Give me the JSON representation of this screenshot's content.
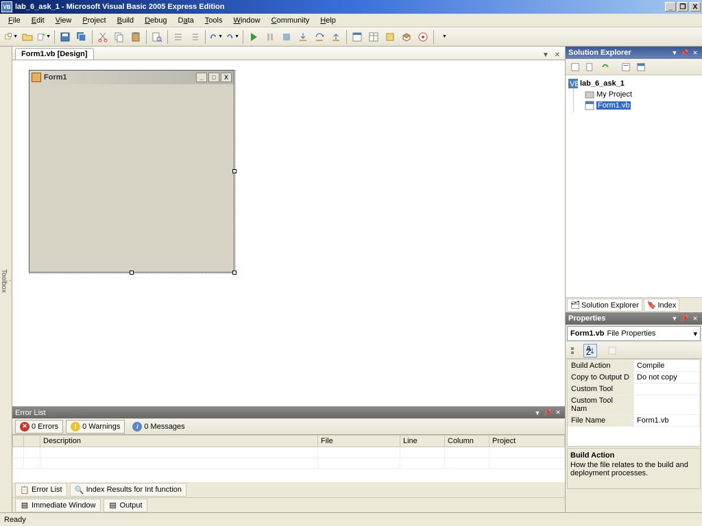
{
  "title": "lab_6_ask_1 - Microsoft Visual Basic 2005 Express Edition",
  "menu": [
    "File",
    "Edit",
    "View",
    "Project",
    "Build",
    "Debug",
    "Data",
    "Tools",
    "Window",
    "Community",
    "Help"
  ],
  "doc_tab": "Form1.vb [Design]",
  "form": {
    "title": "Form1"
  },
  "error_list": {
    "header": "Error List",
    "errors": "0 Errors",
    "warnings": "0 Warnings",
    "messages": "0 Messages",
    "cols": {
      "desc": "Description",
      "file": "File",
      "line": "Line",
      "col": "Column",
      "proj": "Project"
    }
  },
  "bottom_tabs": {
    "errlist": "Error List",
    "index": "Index Results for Int function"
  },
  "bottom_tabs2": {
    "imm": "Immediate Window",
    "out": "Output"
  },
  "solution_explorer": {
    "header": "Solution Explorer",
    "root": "lab_6_ask_1",
    "myproject": "My Project",
    "form": "Form1.vb",
    "tabs": {
      "se": "Solution Explorer",
      "idx": "Index"
    }
  },
  "properties": {
    "header": "Properties",
    "object_name": "Form1.vb",
    "object_type": "File Properties",
    "rows": {
      "build_action": {
        "n": "Build Action",
        "v": "Compile"
      },
      "copy": {
        "n": "Copy to Output D",
        "v": "Do not copy"
      },
      "ctool": {
        "n": "Custom Tool",
        "v": ""
      },
      "ctoolns": {
        "n": "Custom Tool Nam",
        "v": ""
      },
      "fname": {
        "n": "File Name",
        "v": "Form1.vb"
      }
    },
    "desc": {
      "title": "Build Action",
      "text": "How the file relates to the build and deployment processes."
    }
  },
  "toolbox_label": "Toolbox",
  "status": "Ready"
}
